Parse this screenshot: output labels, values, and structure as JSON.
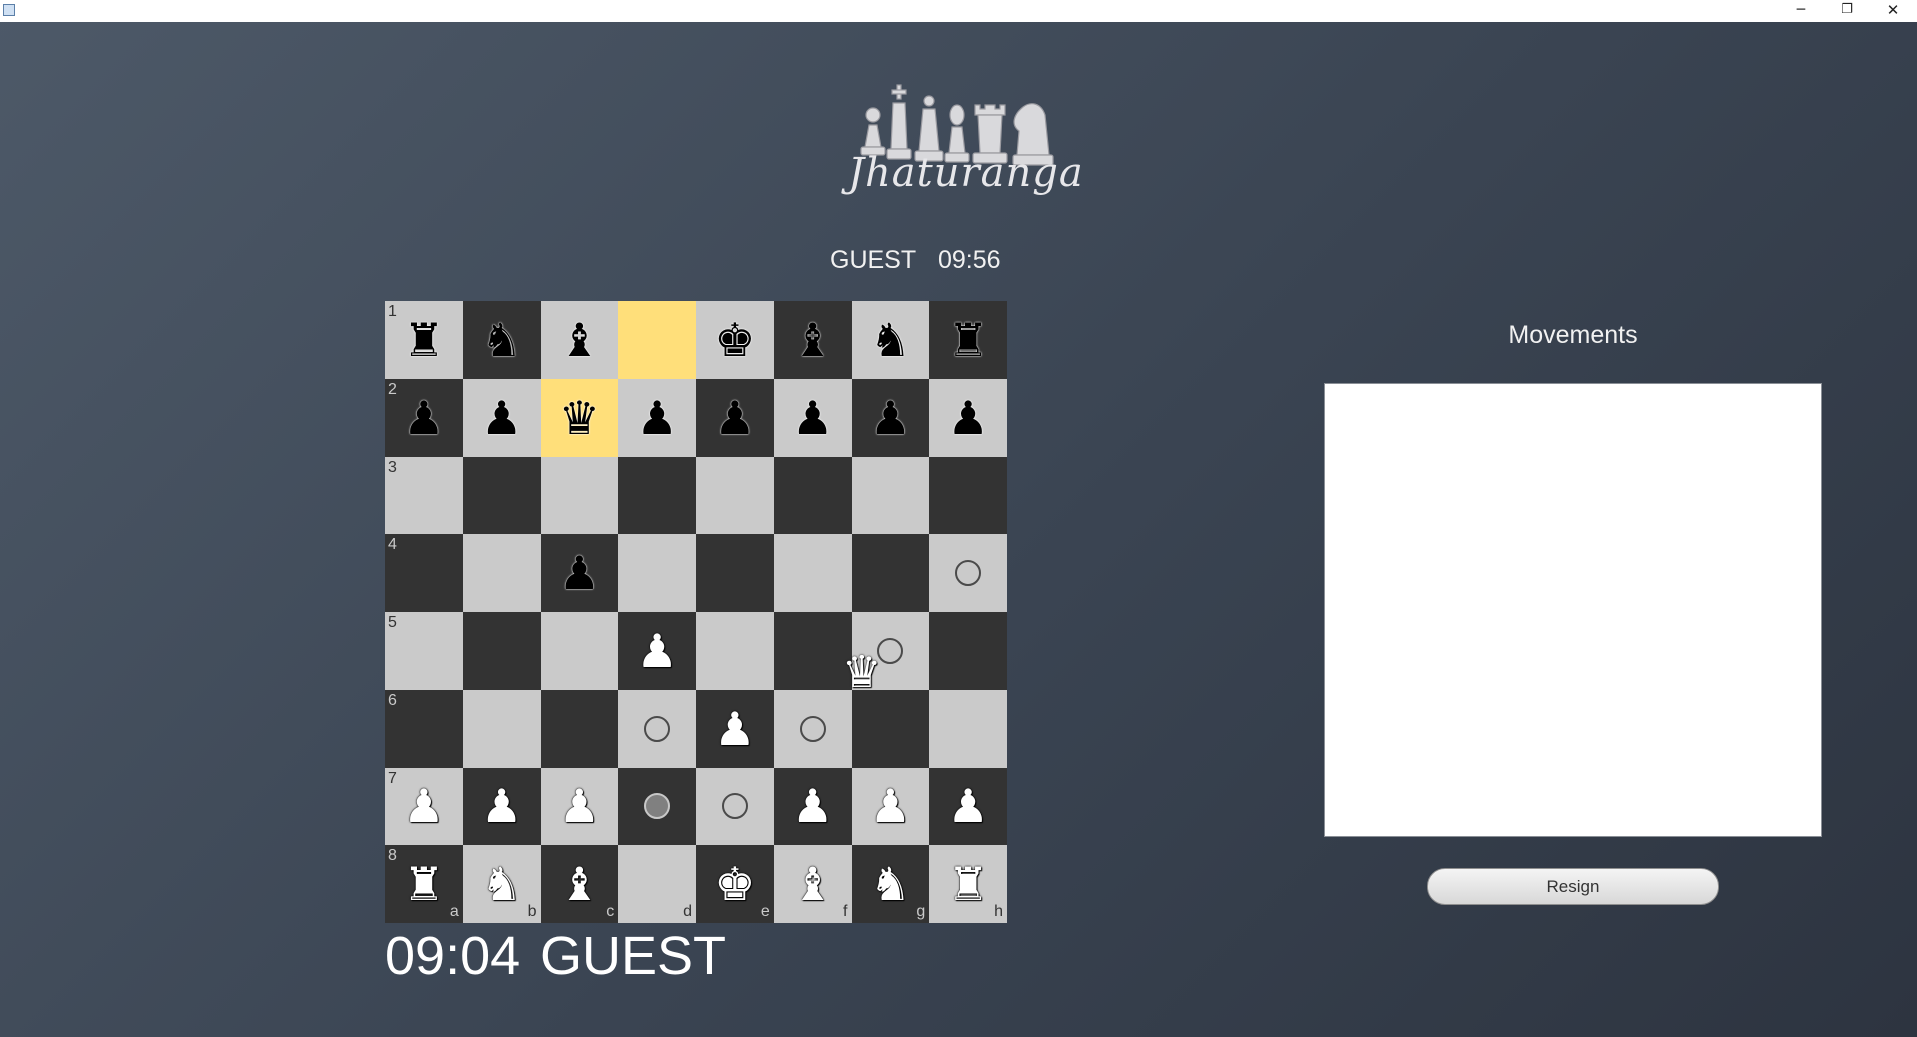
{
  "window": {
    "minimize": "─",
    "maximize": "❐",
    "close": "✕"
  },
  "logo": {
    "pieces": [
      "♟",
      "♝",
      "♚",
      "♛",
      "♜",
      "♞"
    ],
    "text": "Jhaturanga"
  },
  "opponent": {
    "name": "GUEST",
    "time": "09:56"
  },
  "player": {
    "name": "GUEST",
    "time": "09:04"
  },
  "movements": {
    "title": "Movements",
    "entries": []
  },
  "resign_label": "Resign",
  "colors": {
    "light": "#cacaca",
    "dark": "#333333",
    "highlight": "#ffdf7a"
  },
  "board": {
    "rank_labels": [
      "1",
      "2",
      "3",
      "4",
      "5",
      "6",
      "7",
      "8"
    ],
    "file_labels": [
      "a",
      "b",
      "c",
      "d",
      "e",
      "f",
      "g",
      "h"
    ],
    "rows": [
      [
        {
          "p": "♜",
          "c": "black"
        },
        {
          "p": "♞",
          "c": "black"
        },
        {
          "p": "♝",
          "c": "black"
        },
        {
          "hl": true
        },
        {
          "p": "♚",
          "c": "black"
        },
        {
          "p": "♝",
          "c": "black"
        },
        {
          "p": "♞",
          "c": "black"
        },
        {
          "p": "♜",
          "c": "black"
        }
      ],
      [
        {
          "p": "♟",
          "c": "black"
        },
        {
          "p": "♟",
          "c": "black"
        },
        {
          "p": "♛",
          "c": "black",
          "hl": true
        },
        {
          "p": "♟",
          "c": "black"
        },
        {
          "p": "♟",
          "c": "black"
        },
        {
          "p": "♟",
          "c": "black"
        },
        {
          "p": "♟",
          "c": "black"
        },
        {
          "p": "♟",
          "c": "black"
        }
      ],
      [
        {},
        {},
        {},
        {},
        {},
        {},
        {},
        {}
      ],
      [
        {},
        {},
        {
          "p": "♟",
          "c": "black"
        },
        {},
        {},
        {},
        {},
        {
          "m": "ring"
        }
      ],
      [
        {},
        {},
        {},
        {
          "p": "♟",
          "c": "white"
        },
        {},
        {},
        {
          "m": "ring"
        },
        {}
      ],
      [
        {},
        {},
        {},
        {
          "m": "ring"
        },
        {
          "p": "♟",
          "c": "white"
        },
        {
          "m": "ring"
        },
        {},
        {}
      ],
      [
        {
          "p": "♟",
          "c": "white"
        },
        {
          "p": "♟",
          "c": "white"
        },
        {
          "p": "♟",
          "c": "white"
        },
        {
          "m": "filled"
        },
        {
          "m": "ring"
        },
        {
          "p": "♟",
          "c": "white"
        },
        {
          "p": "♟",
          "c": "white"
        },
        {
          "p": "♟",
          "c": "white"
        }
      ],
      [
        {
          "p": "♜",
          "c": "white"
        },
        {
          "p": "♞",
          "c": "white"
        },
        {
          "p": "♝",
          "c": "white"
        },
        {},
        {
          "p": "♚",
          "c": "white"
        },
        {
          "p": "♝",
          "c": "white"
        },
        {
          "p": "♞",
          "c": "white"
        },
        {
          "p": "♜",
          "c": "white"
        }
      ]
    ],
    "dragged_piece": {
      "p": "♛",
      "c": "white"
    }
  }
}
